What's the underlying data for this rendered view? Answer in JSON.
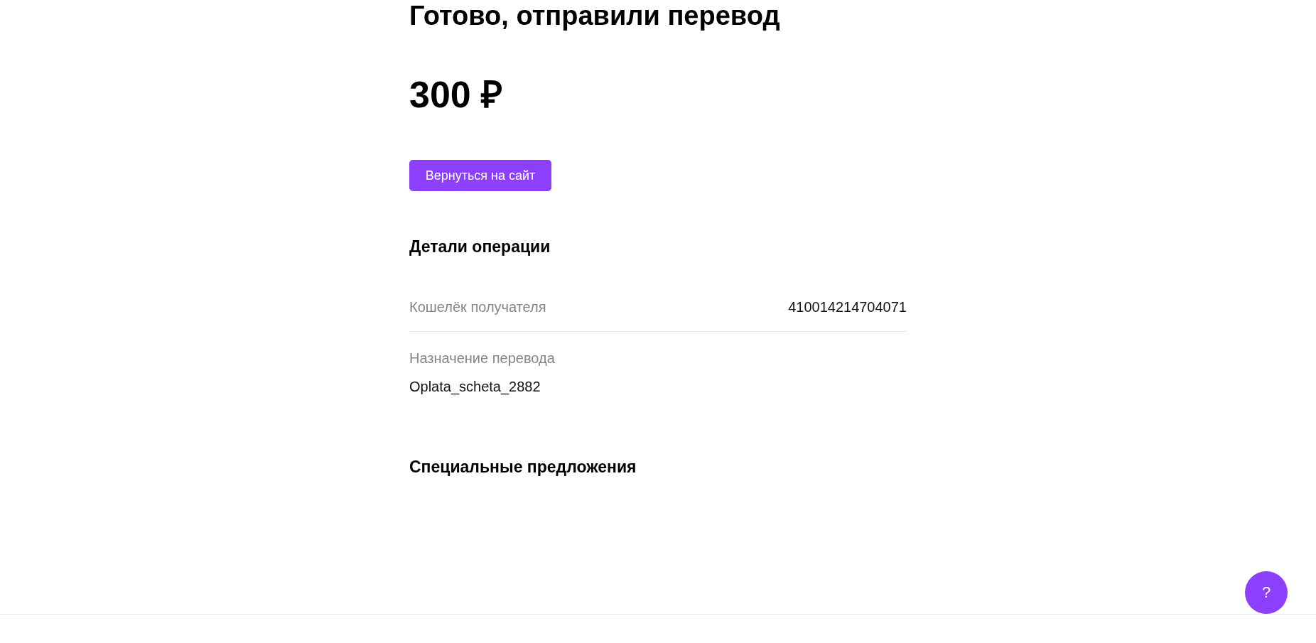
{
  "title": "Готово, отправили перевод",
  "amount": "300 ₽",
  "return_button": {
    "label": "Вернуться на сайт"
  },
  "details": {
    "heading": "Детали операции",
    "rows": [
      {
        "kind": "inline",
        "label": "Кошелёк получателя",
        "value": "410014214704071"
      },
      {
        "kind": "stacked",
        "label": "Назначение перевода",
        "value": "Oplata_scheta_2882"
      }
    ]
  },
  "offers": {
    "heading": "Специальные предложения"
  },
  "help_button": {
    "label": "?"
  }
}
